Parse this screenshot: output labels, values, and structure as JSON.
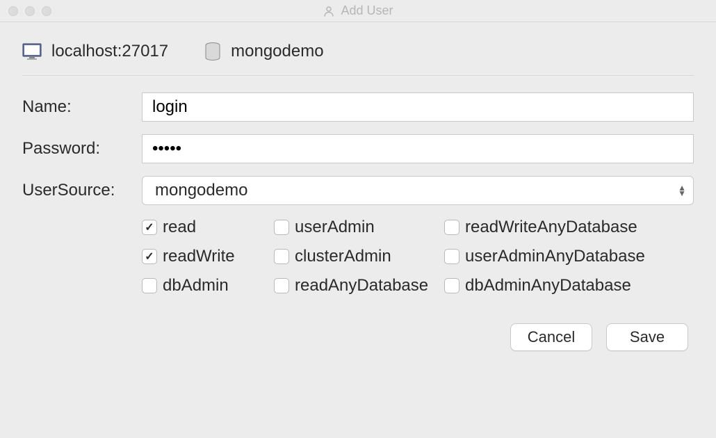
{
  "window": {
    "title": "Add User"
  },
  "header": {
    "host": "localhost:27017",
    "database": "mongodemo"
  },
  "form": {
    "name_label": "Name:",
    "name_value": "login",
    "password_label": "Password:",
    "password_value": "•••••",
    "usersource_label": "UserSource:",
    "usersource_value": "mongodemo"
  },
  "roles": [
    {
      "label": "read",
      "checked": true
    },
    {
      "label": "userAdmin",
      "checked": false
    },
    {
      "label": "readWriteAnyDatabase",
      "checked": false
    },
    {
      "label": "readWrite",
      "checked": true
    },
    {
      "label": "clusterAdmin",
      "checked": false
    },
    {
      "label": "userAdminAnyDatabase",
      "checked": false
    },
    {
      "label": "dbAdmin",
      "checked": false
    },
    {
      "label": "readAnyDatabase",
      "checked": false
    },
    {
      "label": "dbAdminAnyDatabase",
      "checked": false
    }
  ],
  "buttons": {
    "cancel": "Cancel",
    "save": "Save"
  }
}
